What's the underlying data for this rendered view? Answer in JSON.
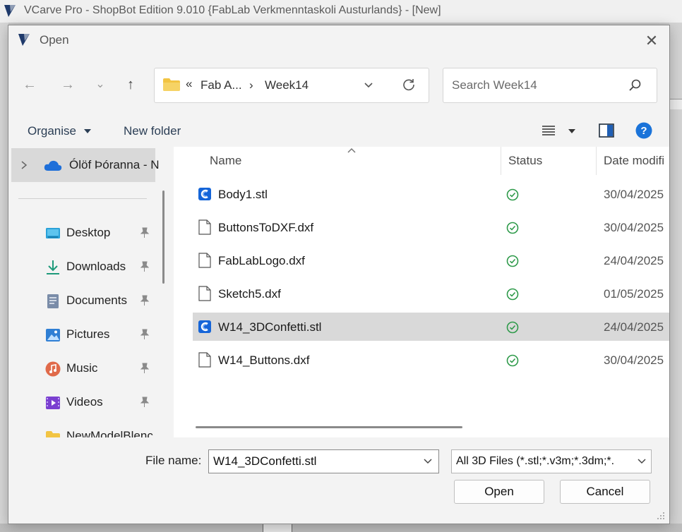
{
  "app": {
    "title": "VCarve Pro - ShopBot Edition 9.010 {FabLab Verkmenntaskoli Austurlands} - [New]",
    "accent": "#1f3a6b"
  },
  "dialog": {
    "title": "Open",
    "close_glyph": "✕",
    "nav": {
      "back": "←",
      "forward": "→",
      "recent": "⌄",
      "up": "↑"
    },
    "address": {
      "chevrons": "«",
      "crumbs": [
        "Fab A...",
        "Week14"
      ],
      "sep": "›"
    },
    "search_placeholder": "Search Week14",
    "toolbar": {
      "organise": "Organise",
      "new_folder": "New folder"
    },
    "sidebar": {
      "onedrive": "Ólöf Þóranna - N",
      "items": [
        {
          "label": "Desktop",
          "icon": "desktop-icon",
          "color": "#2aa1d8"
        },
        {
          "label": "Downloads",
          "icon": "download-icon",
          "color": "#1e9a7a"
        },
        {
          "label": "Documents",
          "icon": "documents-icon",
          "color": "#7a8ca8"
        },
        {
          "label": "Pictures",
          "icon": "pictures-icon",
          "color": "#2f7fd4"
        },
        {
          "label": "Music",
          "icon": "music-icon",
          "color": "#e06a4a"
        },
        {
          "label": "Videos",
          "icon": "videos-icon",
          "color": "#7a3fd0"
        },
        {
          "label": "NewModelBlenc",
          "icon": "folder-icon",
          "color": "#f2c443"
        }
      ]
    },
    "columns": {
      "name": "Name",
      "status": "Status",
      "date": "Date modifi"
    },
    "files": [
      {
        "name": "Body1.stl",
        "type": "stl",
        "date": "30/04/2025",
        "selected": false
      },
      {
        "name": "ButtonsToDXF.dxf",
        "type": "dxf",
        "date": "30/04/2025",
        "selected": false
      },
      {
        "name": "FabLabLogo.dxf",
        "type": "dxf",
        "date": "24/04/2025",
        "selected": false
      },
      {
        "name": "Sketch5.dxf",
        "type": "dxf",
        "date": "01/05/2025",
        "selected": false
      },
      {
        "name": "W14_3DConfetti.stl",
        "type": "stl",
        "date": "24/04/2025",
        "selected": true
      },
      {
        "name": "W14_Buttons.dxf",
        "type": "dxf",
        "date": "30/04/2025",
        "selected": false
      }
    ],
    "footer": {
      "file_name_label": "File name:",
      "file_name_value": "W14_3DConfetti.stl",
      "file_type_value": "All 3D Files (*.stl;*.v3m;*.3dm;*.",
      "open_label": "Open",
      "cancel_label": "Cancel"
    }
  }
}
